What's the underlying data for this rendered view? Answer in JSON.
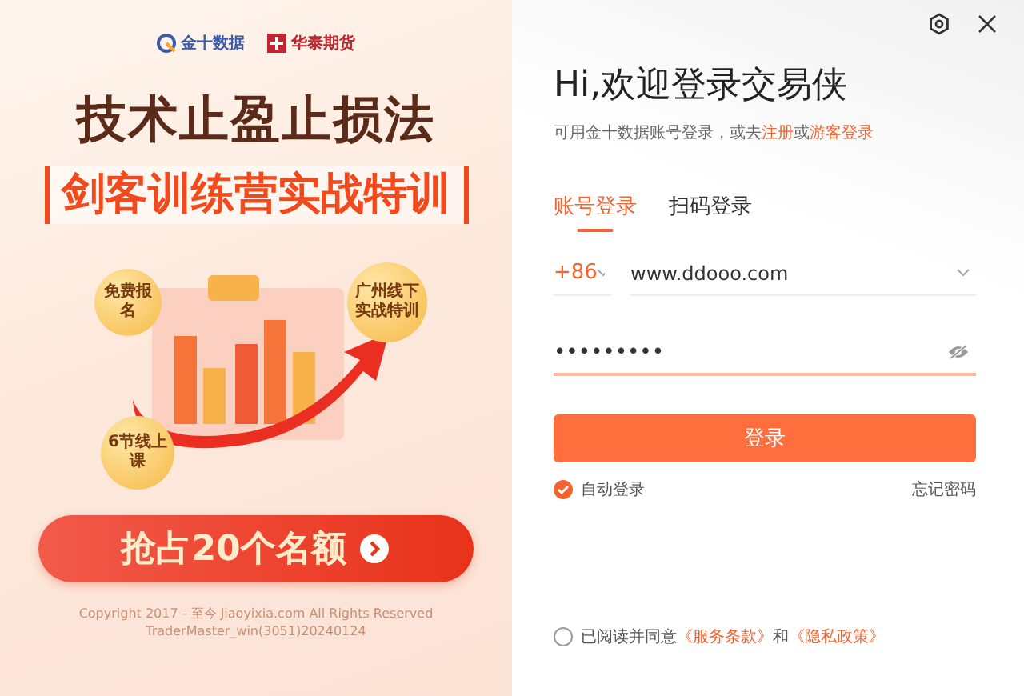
{
  "window": {
    "controls": [
      {
        "kind": "settings"
      },
      {
        "kind": "close"
      }
    ]
  },
  "banner": {
    "logos": [
      "金十数据",
      "华泰期货"
    ],
    "headline": "技术止盈止损法",
    "subheadline": "剑客训练营实战特训",
    "badges": [
      "免费报名",
      "广州线下实战特训",
      "6节线上课"
    ],
    "cta": "抢占20个名额",
    "copyright": [
      "Copyright 2017 - 至今 Jiaoyixia.com All Rights Reserved",
      "TraderMaster_win(3051)20240124"
    ]
  },
  "login": {
    "title": "Hi,欢迎登录交易侠",
    "subtitle": [
      {
        "kind": "text",
        "text": "可用金十数据账号登录，或去"
      },
      {
        "kind": "link",
        "text": "注册"
      },
      {
        "kind": "text",
        "text": "或"
      },
      {
        "kind": "link",
        "text": "游客登录"
      }
    ],
    "tabs": [
      {
        "label": "账号登录",
        "selected": true
      },
      {
        "label": "扫码登录",
        "selected": false
      }
    ],
    "country_code": "+86",
    "account": "www.ddooo.com",
    "password": "•••••••••",
    "submit": "登录",
    "auto_login": {
      "label": "自动登录",
      "checked": true
    },
    "forgot": "忘记密码",
    "agreement": {
      "checked": false,
      "parts": [
        {
          "kind": "text",
          "text": "已阅读并同意"
        },
        {
          "kind": "link",
          "text": "《服务条款》"
        },
        {
          "kind": "text",
          "text": "和"
        },
        {
          "kind": "link",
          "text": "《隐私政策》"
        }
      ]
    }
  }
}
